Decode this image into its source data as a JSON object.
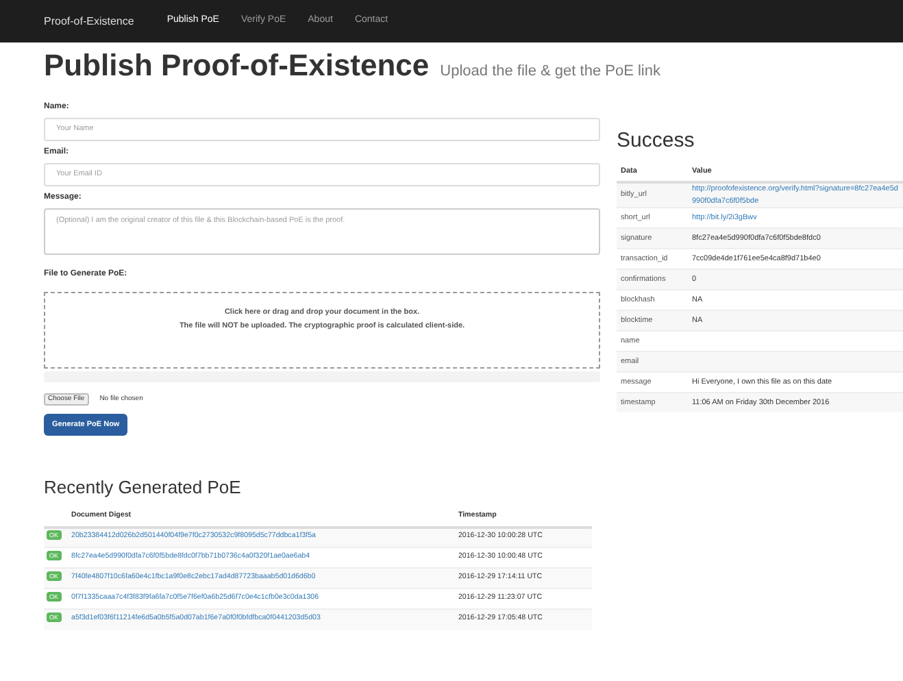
{
  "navbar": {
    "brand": "Proof-of-Existence",
    "links": [
      {
        "label": "Publish PoE",
        "selected": true
      },
      {
        "label": "Verify PoE",
        "selected": false
      },
      {
        "label": "About",
        "selected": false
      },
      {
        "label": "Contact",
        "selected": false
      }
    ]
  },
  "header": {
    "title": "Publish Proof-of-Existence",
    "subtitle": "Upload the file & get the PoE link"
  },
  "form": {
    "fields": [
      {
        "label": "Name:",
        "placeholder": "Your Name",
        "kind": "input"
      },
      {
        "label": "Email:",
        "placeholder": "Your Email ID",
        "kind": "input"
      },
      {
        "label": "Message:",
        "placeholder": "(Optional) I am the original creator of this file & this Blockchain-based PoE is the proof.",
        "kind": "textarea"
      }
    ],
    "file_label": "File to Generate PoE:",
    "dropzone": [
      "Click here or drag and drop your document in the box.",
      "The file will NOT be uploaded. The cryptographic proof is calculated client-side."
    ],
    "choose_button": "Choose File",
    "no_file": "No file chosen",
    "submit": "Generate PoE Now"
  },
  "success": {
    "title": "Success",
    "columns": [
      "Data",
      "Value"
    ],
    "rows": [
      {
        "key": "bitly_url",
        "value": "http://proofofexistence.org/verify.html?signature=8fc27ea4e5d990f0dfa7c6f0f5bde",
        "kind": "link"
      },
      {
        "key": "short_url",
        "value": "http://bit.ly/2i3gBwv",
        "kind": "link"
      },
      {
        "key": "signature",
        "value": "8fc27ea4e5d990f0dfa7c6f0f5bde8fdc0",
        "kind": "text"
      },
      {
        "key": "transaction_id",
        "value": "7cc09de4de1f761ee5e4ca8f9d71b4e0",
        "kind": "text"
      },
      {
        "key": "confirmations",
        "value": "0",
        "kind": "text"
      },
      {
        "key": "blockhash",
        "value": "NA",
        "kind": "text"
      },
      {
        "key": "blocktime",
        "value": "NA",
        "kind": "text"
      },
      {
        "key": "name"
      },
      {
        "key": "email"
      },
      {
        "key": "message",
        "value": "Hi Everyone, I own this file as on this date",
        "kind": "text"
      },
      {
        "key": "timestamp",
        "value": "11:06 AM on Friday 30th December 2016",
        "kind": "text"
      }
    ]
  },
  "recent": {
    "title": "Recently Generated PoE",
    "columns": [
      "Document Digest",
      "Timestamp"
    ],
    "rows": [
      {
        "badge": "OK",
        "digest": "20b23384412d026b2d501440f04f9e7f0c2730532c9f8095d5c77ddbca1f3f5a",
        "timestamp": "2016-12-30 10:00:28 UTC"
      },
      {
        "badge": "OK",
        "digest": "8fc27ea4e5d990f0dfa7c6f0f5bde8fdc0f7bb71b0736c4a0f320f1ae0ae6ab4",
        "timestamp": "2016-12-30 10:00:48 UTC"
      },
      {
        "badge": "OK",
        "digest": "7f40fe4807f10c6fa60e4c1fbc1a9f0e8c2ebc17ad4d87723baaab5d01d6d6b0",
        "timestamp": "2016-12-29 17:14:11 UTC"
      },
      {
        "badge": "OK",
        "digest": "0f7f1335caaa7c4f3f83f9fa6fa7c0f5e7f6ef0a6b25d6f7c0e4c1cfb0e3c0da1306",
        "timestamp": "2016-12-29 11:23:07 UTC"
      },
      {
        "badge": "OK",
        "digest": "a5f3d1ef03f6f11214fe6d5a0b5f5a0d07ab1f6e7a0f0f0bfdfbca0f0441203d5d03",
        "timestamp": "2016-12-29 17:05:48 UTC"
      }
    ]
  }
}
